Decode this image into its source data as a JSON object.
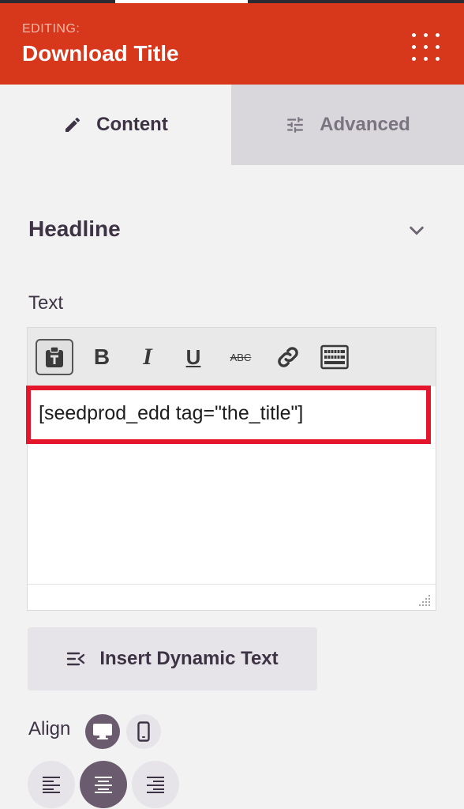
{
  "header": {
    "editing_label": "EDITING:",
    "title": "Download Title",
    "bg_color": "#d7371a",
    "menu_icon": "grid-dots-icon"
  },
  "tabs": [
    {
      "label": "Content",
      "icon": "pencil-icon",
      "active": true
    },
    {
      "label": "Advanced",
      "icon": "sliders-icon",
      "active": false
    }
  ],
  "section": {
    "title": "Headline",
    "toggle_icon": "chevron-down-icon"
  },
  "text_field": {
    "label": "Text",
    "toolbar": {
      "paste": "paste-text-icon",
      "bold": "B",
      "italic": "I",
      "underline": "U",
      "strikethrough": "ABC",
      "link": "link-icon",
      "toolbar_toggle": "keyboard-icon"
    },
    "value": "[seedprod_edd tag=\"the_title\"]",
    "highlight_color": "#e3162b"
  },
  "insert_button": {
    "label": "Insert Dynamic Text",
    "icon": "dynamic-text-icon"
  },
  "align": {
    "label": "Align",
    "devices": [
      {
        "name": "desktop-icon",
        "active": true
      },
      {
        "name": "mobile-icon",
        "active": false
      }
    ],
    "options": [
      {
        "name": "align-left-icon",
        "active": false
      },
      {
        "name": "align-center-icon",
        "active": true
      },
      {
        "name": "align-right-icon",
        "active": false
      }
    ]
  }
}
